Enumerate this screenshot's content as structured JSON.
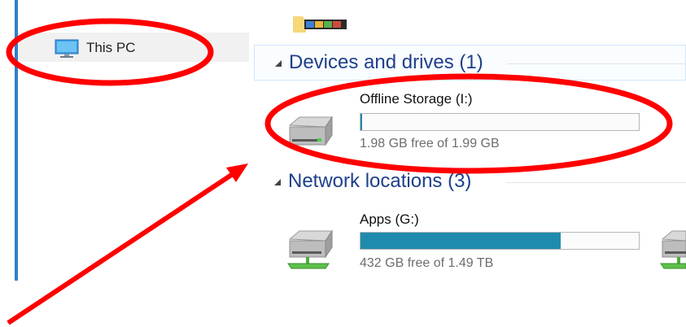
{
  "nav": {
    "this_pc_label": "This PC"
  },
  "groups": {
    "devices_label": "Devices and drives (1)",
    "network_label": "Network locations (3)"
  },
  "devices": [
    {
      "name": "Offline Storage (I:)",
      "free_text": "1.98 GB free of 1.99 GB",
      "used_fraction": 0.005
    }
  ],
  "network": [
    {
      "name": "Apps (G:)",
      "free_text": "432 GB free of 1.49 TB",
      "used_fraction": 0.72
    }
  ],
  "colors": {
    "accent": "#2f7fcf",
    "header_text": "#1e3f8a",
    "bar_fill": "#1f8bac",
    "annotation": "#ff0000"
  }
}
